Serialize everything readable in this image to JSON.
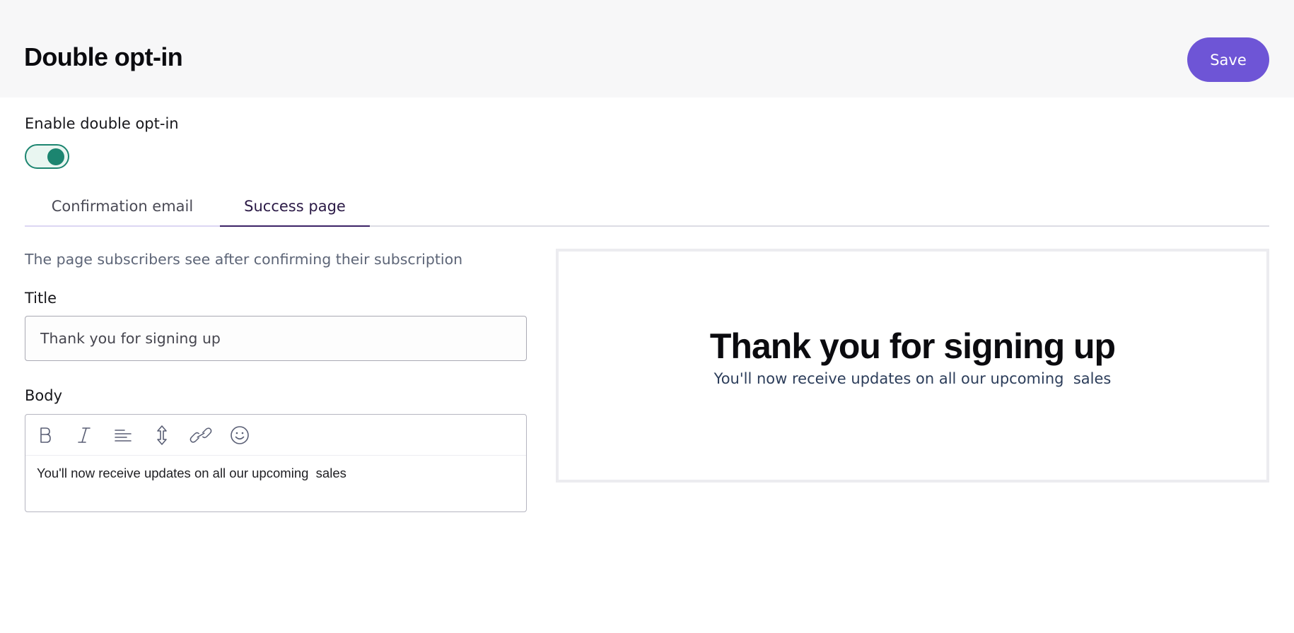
{
  "header": {
    "title": "Double opt-in",
    "save_label": "Save",
    "accent_color": "#6e55d6"
  },
  "toggle": {
    "label": "Enable double opt-in",
    "enabled": true,
    "color": "#1c8570"
  },
  "tabs": [
    {
      "label": "Confirmation email",
      "active": false
    },
    {
      "label": "Success page",
      "active": true
    }
  ],
  "form": {
    "description": "The page subscribers see after confirming their subscription",
    "title_label": "Title",
    "title_value": "Thank you for signing up",
    "body_label": "Body",
    "body_value": "You'll now receive updates on all our upcoming  sales",
    "toolbar_icons": [
      "bold-icon",
      "italic-icon",
      "align-left-icon",
      "line-height-icon",
      "link-icon",
      "emoji-icon"
    ]
  },
  "preview": {
    "title": "Thank you for signing up",
    "body": "You'll now receive updates on all our upcoming  sales"
  }
}
